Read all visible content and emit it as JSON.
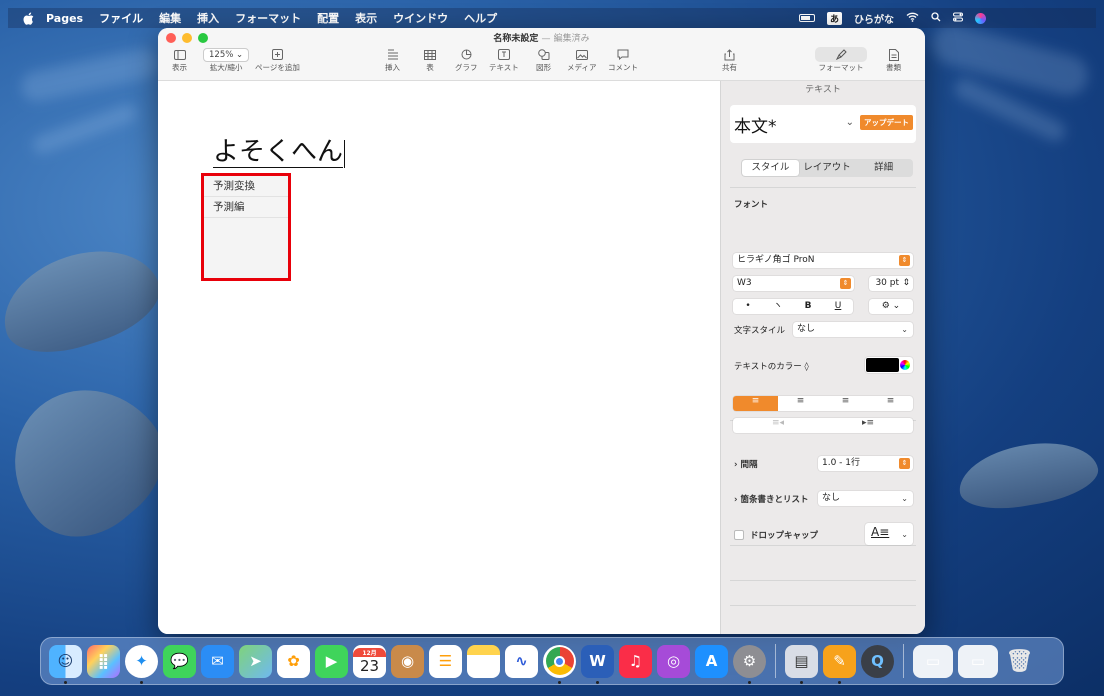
{
  "menubar": {
    "app": "Pages",
    "items": [
      "ファイル",
      "編集",
      "挿入",
      "フォーマット",
      "配置",
      "表示",
      "ウインドウ",
      "ヘルプ"
    ],
    "ime_badge": "あ",
    "ime_label": "ひらがな"
  },
  "window": {
    "title": "名称未設定",
    "title_sep": "—",
    "title_status": "編集済み",
    "zoom": "125%",
    "toolbar": {
      "view": "表示",
      "zoom": "拡大/縮小",
      "add_page": "ページを追加",
      "insert": "挿入",
      "table": "表",
      "chart": "グラフ",
      "text": "テキスト",
      "shape": "図形",
      "media": "メディア",
      "comment": "コメント",
      "share": "共有",
      "format": "フォーマット",
      "document": "書類"
    }
  },
  "document": {
    "typed_text": "よそくへん",
    "suggestions": [
      "予測変換",
      "予測編"
    ]
  },
  "sidebar": {
    "header": "テキスト",
    "style_name": "本文*",
    "update_button": "アップデート",
    "tabs": [
      "スタイル",
      "レイアウト",
      "詳細"
    ],
    "font_label": "フォント",
    "font_family": "ヒラギノ角ゴ ProN",
    "font_weight": "W3",
    "font_size": "30 pt",
    "format_buttons": [
      "•",
      "ヽ",
      "B",
      "U"
    ],
    "char_style_label": "文字スタイル",
    "char_style_value": "なし",
    "text_color_label": "テキストのカラー ◊",
    "text_color": "#000000",
    "spacing_label": "間隔",
    "spacing_value": "1.0 - 1行",
    "bullets_label": "箇条書きとリスト",
    "bullets_value": "なし",
    "dropcap_label": "ドロップキャップ",
    "accent": "#f08a2c"
  },
  "dock": {
    "calendar_month": "12月",
    "calendar_day": "23"
  }
}
